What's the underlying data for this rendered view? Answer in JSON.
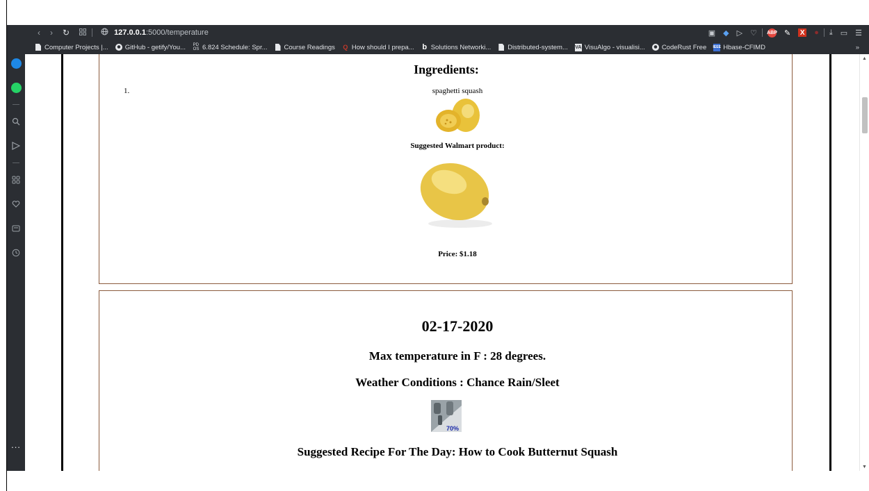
{
  "browser": {
    "url_host": "127.0.0.1",
    "url_path": ":5000/temperature",
    "nav_icons": [
      "back-icon",
      "forward-icon",
      "reload-icon",
      "tabs-grid-icon"
    ],
    "toolbar_right_icons": [
      "camera-icon",
      "shield-icon",
      "play-icon",
      "heart-icon",
      "adblock-icon",
      "pen-icon",
      "x-extension-icon",
      "dot-icon",
      "download-icon",
      "window-icon",
      "menu-icon"
    ],
    "adblock_label": "ABP",
    "x_label": "X",
    "bookmarks": [
      {
        "label": "Computer Projects |...",
        "icon": "doc-icon"
      },
      {
        "label": "GitHub - getify/You...",
        "icon": "github-icon"
      },
      {
        "label": "6.824 Schedule: Spr...",
        "icon": "pdos-icon"
      },
      {
        "label": "Course Readings",
        "icon": "doc-icon"
      },
      {
        "label": "How should I prepa...",
        "icon": "quora-icon"
      },
      {
        "label": "Solutions Networki...",
        "icon": "b-icon"
      },
      {
        "label": "Distributed-system...",
        "icon": "doc-icon"
      },
      {
        "label": "VisuAlgo - visualisi...",
        "icon": "visualgo-icon"
      },
      {
        "label": "CodeRust Free",
        "icon": "github-icon"
      },
      {
        "label": "Hbase-CFIMD",
        "icon": "ieee-icon"
      }
    ],
    "bookmarks_more": "»",
    "sidebar_more": "..."
  },
  "page": {
    "ingredients_heading": "Ingredients:",
    "list_number": "1.",
    "ingredient_name": "spaghetti squash",
    "suggested_label": "Suggested Walmart product:",
    "price": "Price: $1.18",
    "date": "02-17-2020",
    "max_temp": "Max temperature in F : 28 degrees.",
    "weather": "Weather Conditions : Chance Rain/Sleet",
    "weather_icon_percent": "70%",
    "recipe": "Suggested Recipe For The Day: How to Cook Butternut Squash"
  },
  "colors": {
    "chrome": "#2b2e33",
    "card_border": "#8b5a3c",
    "squash_yellow": "#e8c547"
  }
}
